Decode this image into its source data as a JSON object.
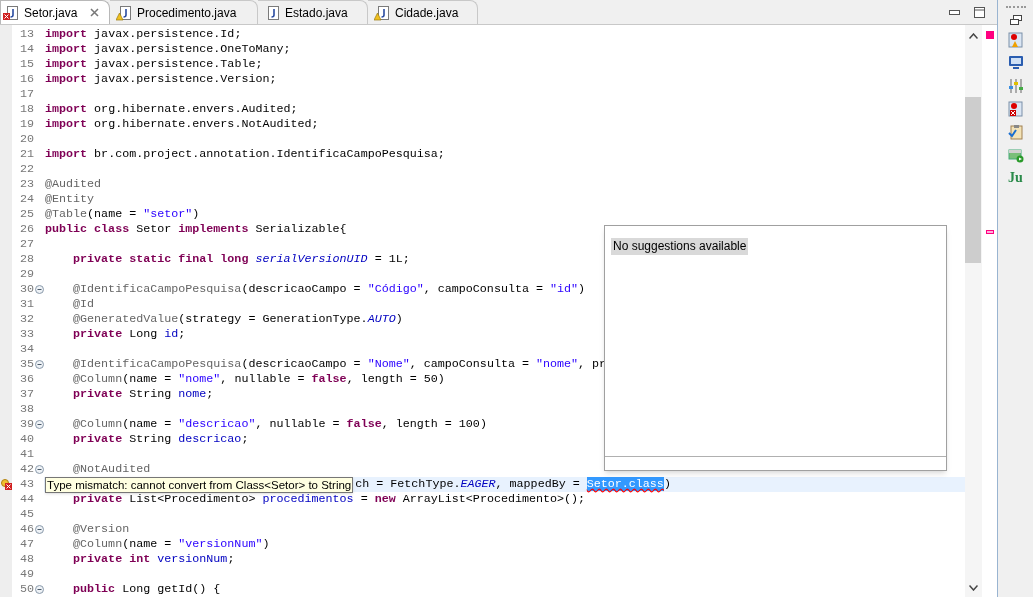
{
  "tabs": [
    {
      "label": "Setor.java",
      "selected": true,
      "kind": "error",
      "closable": true
    },
    {
      "label": "Procedimento.java",
      "selected": false,
      "kind": "warning",
      "closable": false
    },
    {
      "label": "Estado.java",
      "selected": false,
      "kind": "plain",
      "closable": false
    },
    {
      "label": "Cidade.java",
      "selected": false,
      "kind": "warning",
      "closable": false
    }
  ],
  "editor": {
    "lines": [
      {
        "number": "13",
        "tokens": [
          {
            "kind": "keyword",
            "text": "import"
          },
          {
            "kind": "plain",
            "text": " javax.persistence.Id;"
          }
        ]
      },
      {
        "number": "14",
        "tokens": [
          {
            "kind": "keyword",
            "text": "import"
          },
          {
            "kind": "plain",
            "text": " javax.persistence.OneToMany;"
          }
        ]
      },
      {
        "number": "15",
        "tokens": [
          {
            "kind": "keyword",
            "text": "import"
          },
          {
            "kind": "plain",
            "text": " javax.persistence.Table;"
          }
        ]
      },
      {
        "number": "16",
        "tokens": [
          {
            "kind": "keyword",
            "text": "import"
          },
          {
            "kind": "plain",
            "text": " javax.persistence.Version;"
          }
        ]
      },
      {
        "number": "17"
      },
      {
        "number": "18",
        "tokens": [
          {
            "kind": "keyword",
            "text": "import"
          },
          {
            "kind": "plain",
            "text": " org.hibernate.envers.Audited;"
          }
        ]
      },
      {
        "number": "19",
        "tokens": [
          {
            "kind": "keyword",
            "text": "import"
          },
          {
            "kind": "plain",
            "text": " org.hibernate.envers.NotAudited;"
          }
        ]
      },
      {
        "number": "20"
      },
      {
        "number": "21",
        "tokens": [
          {
            "kind": "keyword",
            "text": "import"
          },
          {
            "kind": "plain",
            "text": " br.com.project.annotation.IdentificaCampoPesquisa;"
          }
        ]
      },
      {
        "number": "22"
      },
      {
        "number": "23",
        "tokens": [
          {
            "kind": "annotation",
            "text": "@Audited"
          }
        ]
      },
      {
        "number": "24",
        "tokens": [
          {
            "kind": "annotation",
            "text": "@Entity"
          }
        ]
      },
      {
        "number": "25",
        "tokens": [
          {
            "kind": "annotation",
            "text": "@Table"
          },
          {
            "kind": "plain",
            "text": "(name = "
          },
          {
            "kind": "string",
            "text": "\"setor\""
          },
          {
            "kind": "plain",
            "text": ")"
          }
        ]
      },
      {
        "number": "26",
        "tokens": [
          {
            "kind": "keyword",
            "text": "public class"
          },
          {
            "kind": "plain",
            "text": " Setor "
          },
          {
            "kind": "keyword",
            "text": "implements"
          },
          {
            "kind": "plain",
            "text": " Serializable{"
          }
        ]
      },
      {
        "number": "27"
      },
      {
        "number": "28",
        "tokens": [
          {
            "kind": "keyword",
            "text": "    private static final long"
          },
          {
            "kind": "static",
            "text": " serialVersionUID"
          },
          {
            "kind": "plain",
            "text": " = 1L;"
          }
        ]
      },
      {
        "number": "29"
      },
      {
        "number": "30",
        "foldable": true,
        "tokens": [
          {
            "kind": "annotation",
            "text": "    @IdentificaCampoPesquisa"
          },
          {
            "kind": "plain",
            "text": "(descricaoCampo = "
          },
          {
            "kind": "string",
            "text": "\"Código\""
          },
          {
            "kind": "plain",
            "text": ", campoConsulta = "
          },
          {
            "kind": "string",
            "text": "\"id\""
          },
          {
            "kind": "plain",
            "text": ")"
          }
        ]
      },
      {
        "number": "31",
        "tokens": [
          {
            "kind": "annotation",
            "text": "    @Id"
          }
        ]
      },
      {
        "number": "32",
        "tokens": [
          {
            "kind": "annotation",
            "text": "    @GeneratedValue"
          },
          {
            "kind": "plain",
            "text": "(strategy = GenerationType."
          },
          {
            "kind": "static",
            "text": "AUTO"
          },
          {
            "kind": "plain",
            "text": ")"
          }
        ]
      },
      {
        "number": "33",
        "tokens": [
          {
            "kind": "keyword",
            "text": "    private"
          },
          {
            "kind": "plain",
            "text": " Long "
          },
          {
            "kind": "field",
            "text": "id"
          },
          {
            "kind": "plain",
            "text": ";"
          }
        ]
      },
      {
        "number": "34"
      },
      {
        "number": "35",
        "foldable": true,
        "tokens": [
          {
            "kind": "annotation",
            "text": "    @IdentificaCampoPesquisa"
          },
          {
            "kind": "plain",
            "text": "(descricaoCampo = "
          },
          {
            "kind": "string",
            "text": "\"Nome\""
          },
          {
            "kind": "plain",
            "text": ", campoConsulta = "
          },
          {
            "kind": "string",
            "text": "\"nome\""
          },
          {
            "kind": "plain",
            "text": ", pr"
          }
        ]
      },
      {
        "number": "36",
        "tokens": [
          {
            "kind": "annotation",
            "text": "    @Column"
          },
          {
            "kind": "plain",
            "text": "(name = "
          },
          {
            "kind": "string",
            "text": "\"nome\""
          },
          {
            "kind": "plain",
            "text": ", nullable = "
          },
          {
            "kind": "keyword",
            "text": "false"
          },
          {
            "kind": "plain",
            "text": ", length = 50)"
          }
        ]
      },
      {
        "number": "37",
        "tokens": [
          {
            "kind": "keyword",
            "text": "    private"
          },
          {
            "kind": "plain",
            "text": " String "
          },
          {
            "kind": "field",
            "text": "nome"
          },
          {
            "kind": "plain",
            "text": ";"
          }
        ]
      },
      {
        "number": "38"
      },
      {
        "number": "39",
        "foldable": true,
        "tokens": [
          {
            "kind": "annotation",
            "text": "    @Column"
          },
          {
            "kind": "plain",
            "text": "(name = "
          },
          {
            "kind": "string",
            "text": "\"descricao\""
          },
          {
            "kind": "plain",
            "text": ", nullable = "
          },
          {
            "kind": "keyword",
            "text": "false"
          },
          {
            "kind": "plain",
            "text": ", length = 100)"
          }
        ]
      },
      {
        "number": "40",
        "tokens": [
          {
            "kind": "keyword",
            "text": "    private"
          },
          {
            "kind": "plain",
            "text": " String "
          },
          {
            "kind": "field",
            "text": "descricao"
          },
          {
            "kind": "plain",
            "text": ";"
          }
        ]
      },
      {
        "number": "41"
      },
      {
        "number": "42",
        "foldable": true,
        "tokens": [
          {
            "kind": "annotation",
            "text": "    @NotAudited"
          }
        ]
      },
      {
        "number": "43",
        "current": true,
        "error": true,
        "tooltip": "Type mismatch: cannot convert from Class<Setor> to String",
        "tokens": [
          {
            "kind": "plain",
            "text": "ch = FetchType."
          },
          {
            "kind": "static",
            "text": "EAGER"
          },
          {
            "kind": "plain",
            "text": ", mappedBy = "
          },
          {
            "kind": "selected",
            "text": "Setor.class"
          },
          {
            "kind": "plain",
            "text": ")"
          }
        ]
      },
      {
        "number": "44",
        "tokens": [
          {
            "kind": "keyword",
            "text": "    private"
          },
          {
            "kind": "plain",
            "text": " List<Procedimento> "
          },
          {
            "kind": "field",
            "text": "procedimentos"
          },
          {
            "kind": "plain",
            "text": " = "
          },
          {
            "kind": "keyword",
            "text": "new"
          },
          {
            "kind": "plain",
            "text": " ArrayList<Procedimento>();"
          }
        ]
      },
      {
        "number": "45"
      },
      {
        "number": "46",
        "foldable": true,
        "tokens": [
          {
            "kind": "annotation",
            "text": "    @Version"
          }
        ]
      },
      {
        "number": "47",
        "tokens": [
          {
            "kind": "annotation",
            "text": "    @Column"
          },
          {
            "kind": "plain",
            "text": "(name = "
          },
          {
            "kind": "string",
            "text": "\"versionNum\""
          },
          {
            "kind": "plain",
            "text": ")"
          }
        ]
      },
      {
        "number": "48",
        "tokens": [
          {
            "kind": "keyword",
            "text": "    private int"
          },
          {
            "kind": "field",
            "text": " versionNum"
          },
          {
            "kind": "plain",
            "text": ";"
          }
        ]
      },
      {
        "number": "49"
      },
      {
        "number": "50",
        "foldable": true,
        "tokens": [
          {
            "kind": "keyword",
            "text": "    public"
          },
          {
            "kind": "plain",
            "text": " Long getId() {"
          }
        ]
      }
    ]
  },
  "popup": {
    "message": "No suggestions available"
  },
  "side_toolbar": {
    "junit_label": "Ju"
  }
}
